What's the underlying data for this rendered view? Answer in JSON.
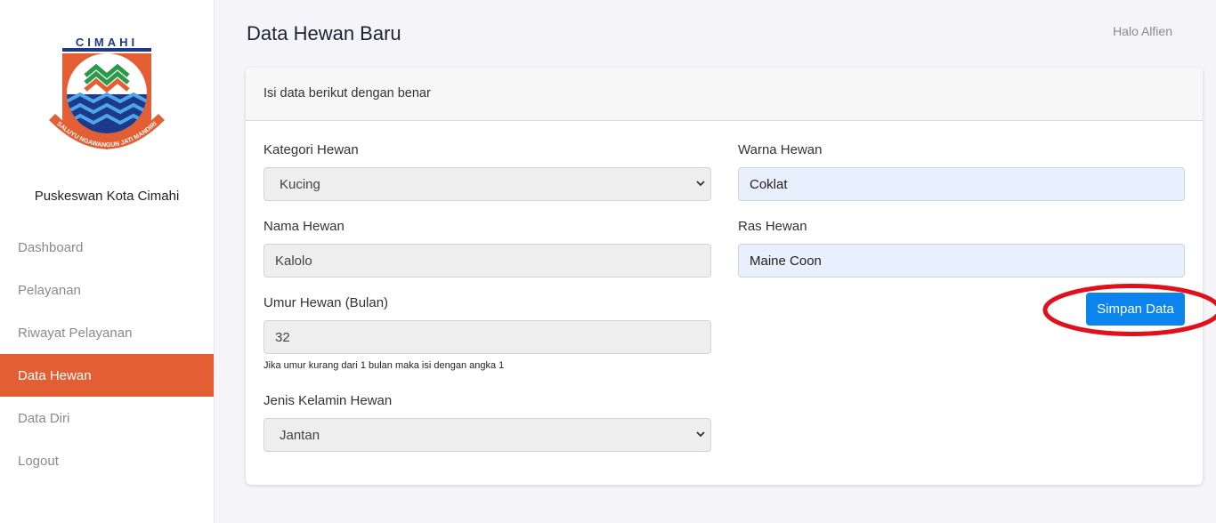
{
  "sidebar": {
    "logo_text": "CIMAHI",
    "logo_motto": "SALUYU NGAWANGUN JATI MANDIRI",
    "org_name": "Puskeswan Kota Cimahi",
    "items": [
      {
        "label": "Dashboard"
      },
      {
        "label": "Pelayanan"
      },
      {
        "label": "Riwayat Pelayanan"
      },
      {
        "label": "Data Hewan"
      },
      {
        "label": "Data Diri"
      },
      {
        "label": "Logout"
      }
    ],
    "active_index": 3
  },
  "header": {
    "title": "Data Hewan Baru",
    "greeting": "Halo Alfien"
  },
  "form": {
    "intro": "Isi data berikut dengan benar",
    "kategori": {
      "label": "Kategori Hewan",
      "value": "Kucing"
    },
    "nama": {
      "label": "Nama Hewan",
      "value": "Kalolo"
    },
    "umur": {
      "label": "Umur Hewan (Bulan)",
      "value": "32",
      "hint": "Jika umur kurang dari 1 bulan maka isi dengan angka 1"
    },
    "kelamin": {
      "label": "Jenis Kelamin Hewan",
      "value": "Jantan"
    },
    "warna": {
      "label": "Warna Hewan",
      "value": "Coklat"
    },
    "ras": {
      "label": "Ras Hewan",
      "value": "Maine Coon"
    },
    "save_label": "Simpan Data"
  },
  "colors": {
    "accent": "#e45e34",
    "primary_button": "#0b84ee",
    "annotation_circle": "#e0111b"
  }
}
